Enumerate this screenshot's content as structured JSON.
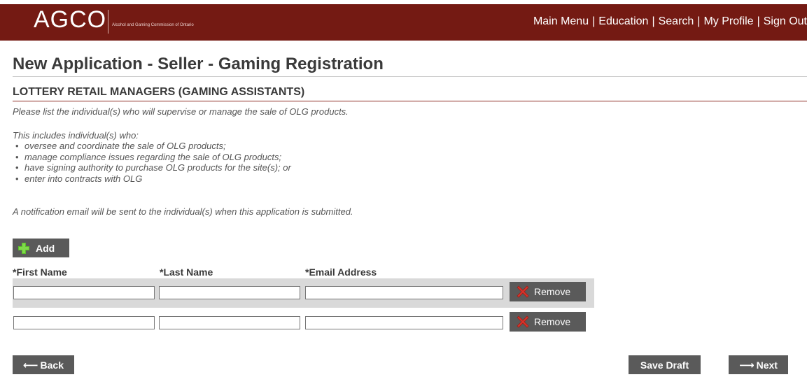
{
  "header": {
    "logo_text": "AGCO",
    "logo_subtitle": "Alcohol and Gaming Commission of Ontario",
    "nav": [
      "Main Menu",
      "Education",
      "Search",
      "My Profile",
      "Sign Out"
    ],
    "separator": "|"
  },
  "page_title": "New Application - Seller - Gaming Registration",
  "section_title": "LOTTERY RETAIL MANAGERS (GAMING ASSISTANTS)",
  "intro_text": "Please list the individual(s) who will supervise or manage the sale of OLG products.",
  "includes_text": "This includes individual(s) who:",
  "bullets": [
    "oversee and coordinate the sale of OLG products;",
    "manage compliance issues regarding the sale of OLG products;",
    "have signing authority to purchase OLG products for the site(s); or",
    "enter into contracts with OLG"
  ],
  "notice_text": "A notification email will be sent to the individual(s) when this application is submitted.",
  "add_button": {
    "label": "Add",
    "icon": "plus-icon"
  },
  "columns": [
    "*First Name",
    "*Last Name",
    "*Email Address"
  ],
  "rows": [
    {
      "first_name": "",
      "last_name": "",
      "email": "",
      "remove_label": "Remove"
    },
    {
      "first_name": "",
      "last_name": "",
      "email": "",
      "remove_label": "Remove"
    }
  ],
  "footer": {
    "back_label": "Back",
    "save_label": "Save Draft",
    "next_label": "Next"
  },
  "colors": {
    "header_bg": "#741a13",
    "button_bg": "#5a5a5a",
    "row_highlight": "#d9d9d9",
    "add_icon": "#5bbf2a",
    "remove_icon": "#d9342b"
  }
}
